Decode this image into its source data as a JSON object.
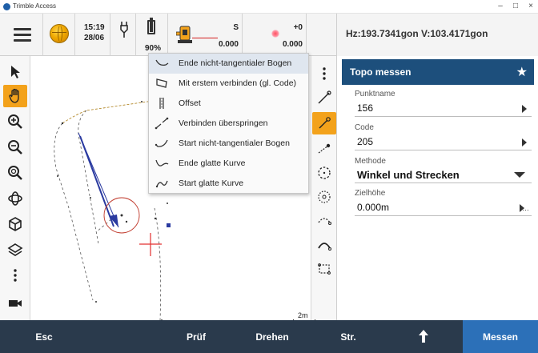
{
  "window": {
    "title": "Trimble Access",
    "minimize": "–",
    "maximize": "□",
    "close": "×"
  },
  "status": {
    "time": "15:19",
    "date": "28/06",
    "battery": "90%",
    "battery_level": 0.9,
    "instrument_top": "S",
    "instrument_bottom": "0.000",
    "laser_top": "+0",
    "laser_bottom": "0.000",
    "hz_v": "Hz:193.7341gon  V:103.4171gon"
  },
  "popup_menu": {
    "items": [
      {
        "label": "Ende nicht-tangentialer Bogen",
        "icon": "end-nontangent-arc-icon"
      },
      {
        "label": "Mit erstem verbinden (gl. Code)",
        "icon": "connect-to-first-icon"
      },
      {
        "label": "Offset",
        "icon": "offset-icon"
      },
      {
        "label": "Verbinden überspringen",
        "icon": "skip-join-icon"
      },
      {
        "label": "Start nicht-tangentialer Bogen",
        "icon": "start-nontangent-arc-icon"
      },
      {
        "label": "Ende glatte Kurve",
        "icon": "end-smooth-curve-icon"
      },
      {
        "label": "Start glatte Kurve",
        "icon": "start-smooth-curve-icon"
      }
    ]
  },
  "map": {
    "scale_label": "2m"
  },
  "panel": {
    "title": "Topo messen",
    "point_name_label": "Punktname",
    "point_name_value": "156",
    "code_label": "Code",
    "code_value": "205",
    "method_label": "Methode",
    "method_value": "Winkel und Strecken",
    "target_height_label": "Zielhöhe",
    "target_height_value": "0.000m"
  },
  "bottom_bar": {
    "esc": "Esc",
    "check": "Prüf",
    "rotate": "Drehen",
    "str": "Str.",
    "measure": "Messen"
  },
  "colors": {
    "accent_orange": "#f3a21b",
    "panel_header": "#1d4f7c",
    "bottom_bar": "#2a3a4c",
    "measure_button": "#2c70b8"
  }
}
